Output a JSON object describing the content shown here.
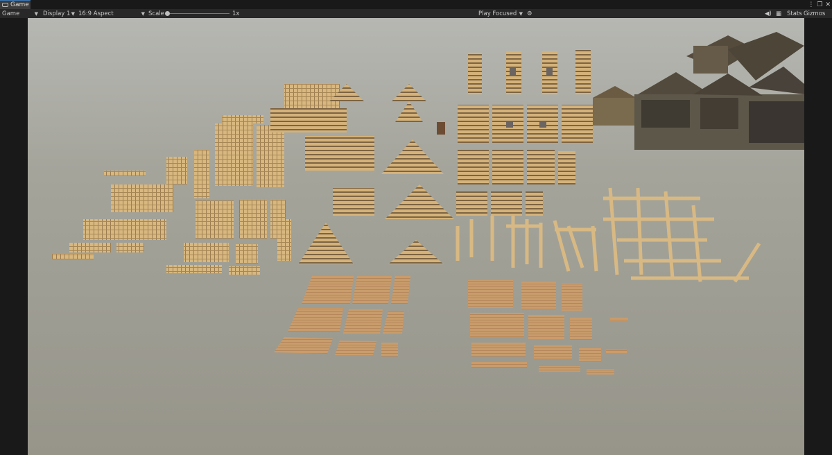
{
  "tab": {
    "label": "Game"
  },
  "toolbar": {
    "view_select": "Game",
    "display_select": "Display 1",
    "aspect_select": "16:9 Aspect",
    "scale_label": "Scale",
    "scale_value": "1x",
    "play_mode_select": "Play Focused",
    "stats_label": "Stats",
    "gizmos_label": "Gizmos"
  },
  "icons": {
    "game_tab": "gamepad-icon",
    "more": "kebab-menu-icon",
    "maximize": "maximize-icon",
    "close": "close-icon",
    "settings": "gear-icon",
    "audio": "speaker-icon",
    "stats_grid": "grid-icon"
  },
  "colors": {
    "editor_bg": "#191919",
    "toolbar_bg": "#282828",
    "tab_bg": "#3c3c3c",
    "accent": "#3a79bb",
    "ground": "#a4a49b",
    "wood_light": "#d6b47c",
    "wood_dark": "#8a6f47",
    "floor": "#c89a6b"
  }
}
